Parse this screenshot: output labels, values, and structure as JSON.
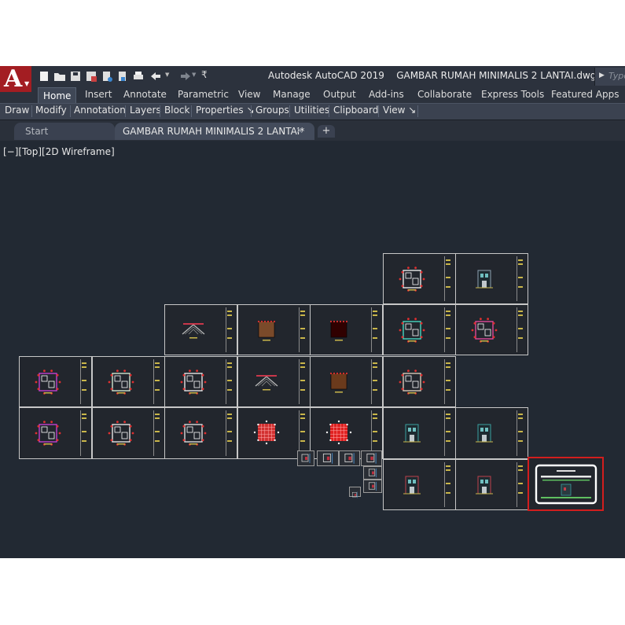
{
  "title_bar": {
    "app_name": "Autodesk AutoCAD 2019",
    "document_name": "GAMBAR RUMAH MINIMALIS 2 LANTAI.dwg",
    "search_placeholder": "Type",
    "app_button_letter": "A"
  },
  "quick_access": [
    "new-icon",
    "open-icon",
    "save-icon",
    "save-as-icon",
    "open-web-icon",
    "save-web-icon",
    "plot-icon",
    "undo-icon",
    "redo-icon",
    "customize-icon"
  ],
  "ribbon_tabs": [
    {
      "label": "Home",
      "active": true
    },
    {
      "label": "Insert",
      "active": false
    },
    {
      "label": "Annotate",
      "active": false
    },
    {
      "label": "Parametric",
      "active": false
    },
    {
      "label": "View",
      "active": false
    },
    {
      "label": "Manage",
      "active": false
    },
    {
      "label": "Output",
      "active": false
    },
    {
      "label": "Add-ins",
      "active": false
    },
    {
      "label": "Collaborate",
      "active": false
    },
    {
      "label": "Express Tools",
      "active": false
    },
    {
      "label": "Featured Apps",
      "active": false
    }
  ],
  "ribbon_panels": [
    "Draw",
    "Modify",
    "Annotation",
    "Layers",
    "Block",
    "Properties ↘",
    "Groups",
    "Utilities",
    "Clipboard",
    "View ↘"
  ],
  "file_tabs": {
    "start": "Start",
    "document": "GAMBAR RUMAH MINIMALIS 2 LANTAI*",
    "close_glyph": "✕",
    "new_glyph": "+"
  },
  "viewport_label": "[−][Top][2D Wireframe]",
  "colors": {
    "canvas_bg": "#222933",
    "brand_red": "#a31d22",
    "selection_red": "#d21e1e",
    "sheet_border": "#c7c7c7"
  },
  "sheets": [
    {
      "kind": "plan-round",
      "accent": "#e8e8e8"
    },
    {
      "kind": "facade",
      "accent": "#8ea0b0"
    },
    {
      "kind": "roof",
      "accent": "#c8374a"
    },
    {
      "kind": "dark-block",
      "accent": "#7a4a2a"
    },
    {
      "kind": "dark-block",
      "accent": "#300000"
    },
    {
      "kind": "plan-round",
      "accent": "#48d8c0"
    },
    {
      "kind": "plan-round",
      "accent": "#e04a9a"
    },
    {
      "kind": "plan-magenta",
      "accent": "#c040d0"
    },
    {
      "kind": "plan-round",
      "accent": "#cfe6d0"
    },
    {
      "kind": "plan-round",
      "accent": "#e6e6e6"
    },
    {
      "kind": "roof",
      "accent": "#c8374a"
    },
    {
      "kind": "dark-block",
      "accent": "#6b3a1c"
    },
    {
      "kind": "plan-round",
      "accent": "#d7c9b8"
    },
    {
      "kind": "plan-magenta",
      "accent": "#c040d0"
    },
    {
      "kind": "plan-round",
      "accent": "#e6e6e6"
    },
    {
      "kind": "plan-round",
      "accent": "#dcdcdc"
    },
    {
      "kind": "red-grid",
      "accent": "#d23030"
    },
    {
      "kind": "red-grid",
      "accent": "#e02020"
    },
    {
      "kind": "facade",
      "accent": "#3aa0a0"
    },
    {
      "kind": "facade",
      "accent": "#3aa0a0"
    },
    {
      "kind": "facade",
      "accent": "#c0404a"
    },
    {
      "kind": "facade",
      "accent": "#c0404a"
    },
    {
      "kind": "cover",
      "accent": "#ffffff"
    }
  ]
}
